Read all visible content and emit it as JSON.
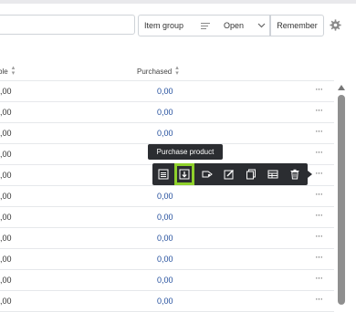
{
  "filters": {
    "item_group_label": "Item group",
    "open_label": "Open",
    "remember_label": "Remember"
  },
  "table": {
    "columns": [
      {
        "label": "ble"
      },
      {
        "label": "Purchased"
      }
    ],
    "rows": [
      {
        "left": ",00",
        "purchased": "0,00"
      },
      {
        "left": ",00",
        "purchased": "0,00"
      },
      {
        "left": ",00",
        "purchased": "0,00"
      },
      {
        "left": ",00",
        "purchased": "0,00"
      },
      {
        "left": ",00",
        "purchased": "0,00"
      },
      {
        "left": ",00",
        "purchased": "0,00"
      },
      {
        "left": ",00",
        "purchased": "0,00"
      },
      {
        "left": ",00",
        "purchased": "0,00"
      },
      {
        "left": ",00",
        "purchased": "0,00"
      },
      {
        "left": ",00",
        "purchased": "0,00"
      },
      {
        "left": ",00",
        "purchased": "0,00"
      }
    ],
    "row_menu": "···"
  },
  "tooltip": {
    "text": "Purchase product"
  },
  "toolbar": {
    "icons": [
      "list-icon",
      "download-arrow-icon",
      "tag-icon",
      "edit-icon",
      "copy-icon",
      "table-icon",
      "trash-icon"
    ],
    "highlight_color": "#8fd12b"
  }
}
